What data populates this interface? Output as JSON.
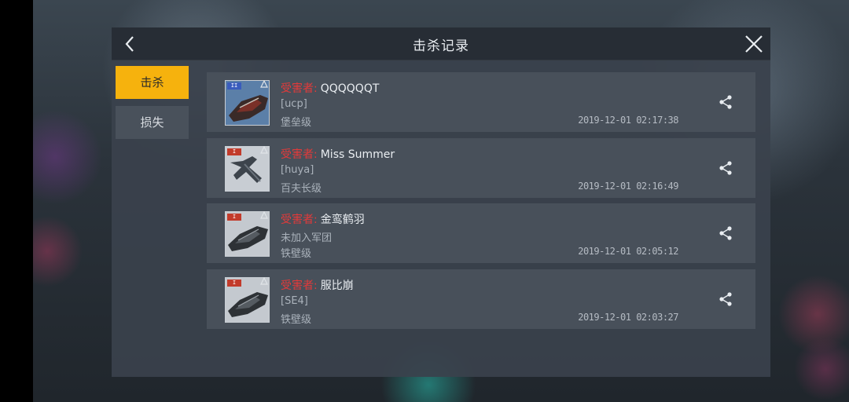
{
  "header": {
    "title": "击杀记录"
  },
  "tabs": [
    {
      "label": "击杀",
      "active": true
    },
    {
      "label": "损失",
      "active": false
    }
  ],
  "records": [
    {
      "rank": "II",
      "rank_color": "blue",
      "victim_label": "受害者:",
      "victim_name": "QQQQQQT",
      "corp": "[ucp]",
      "ship_class": "堡垒级",
      "time": "2019-12-01 02:17:38"
    },
    {
      "rank": "I",
      "rank_color": "red",
      "victim_label": "受害者:",
      "victim_name": "Miss Summer",
      "corp": "[huya]",
      "ship_class": "百夫长级",
      "time": "2019-12-01 02:16:49"
    },
    {
      "rank": "I",
      "rank_color": "red",
      "victim_label": "受害者:",
      "victim_name": "金鸾鹤羽",
      "corp": "未加入军团",
      "ship_class": "铁壁级",
      "time": "2019-12-01 02:05:12"
    },
    {
      "rank": "I",
      "rank_color": "red",
      "victim_label": "受害者:",
      "victim_name": "服比崩",
      "corp": "[SE4]",
      "ship_class": "铁壁级",
      "time": "2019-12-01 02:03:27"
    }
  ],
  "colors": {
    "accent": "#f6b20d",
    "victim_label": "#e23a3a"
  }
}
